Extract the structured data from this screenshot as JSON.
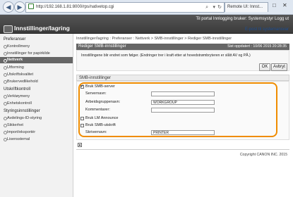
{
  "browser": {
    "url": "http://192.168.1.81:8000/rps/nativetop.cgi",
    "tab_label": "Remote UI: Innst...",
    "back_icon": "back-arrow-icon",
    "forward_icon": "forward-arrow-icon",
    "refresh_icon": "refresh-icon",
    "lock_icon": "lock-icon",
    "window_controls": [
      "□",
      "✕"
    ]
  },
  "header": {
    "top_links": "Til portal   Innlogging bruker: Systemsystyr   Logg ut",
    "user": "",
    "title": "Innstillinger/lagring",
    "email_link": "E-post til systemansvar"
  },
  "sidebar": {
    "categories": [
      {
        "name": "Preferanser",
        "items": [
          {
            "label": "Kontrollmeny",
            "active": false
          },
          {
            "label": "Innstillinger for papirkilde",
            "active": false
          },
          {
            "label": "Nettverk",
            "active": true
          },
          {
            "label": "Utforming",
            "active": false
          },
          {
            "label": "Utskriftskvalitet",
            "active": false
          },
          {
            "label": "Brukervedlikehold",
            "active": false
          }
        ]
      },
      {
        "name": "Utskriftkontroll",
        "items": [
          {
            "label": "Verktøymeny",
            "active": false
          },
          {
            "label": "Enhetskontroll",
            "active": false
          }
        ]
      },
      {
        "name": "Styringsinnstillinger",
        "items": [
          {
            "label": "Avdelings-ID-styring",
            "active": false
          },
          {
            "label": "Sikkerhet",
            "active": false
          },
          {
            "label": "Import/eksportér",
            "active": false
          },
          {
            "label": "Lisensstemal",
            "active": false
          }
        ]
      }
    ]
  },
  "main": {
    "breadcrumb": "Innstillinger/lagring : Preferanser : Nettverk > SMB-innstillinger > Rediger SMB-innstillinger",
    "edit_bar_title": "Rediger SMB-innstillinger",
    "edit_bar_right": "Sist oppdatert : 10/06 2015 20:28:35",
    "message": "Innstillingene blir endret som følger. (Endringer trer i kraft etter at hovedstrømbryteren er slått AV og PÅ.)",
    "ok_label": "OK",
    "cancel_label": "Avbryt",
    "section_title": "SMB-innstillinger",
    "fields": {
      "use_smb_server": {
        "label": "Bruk SMB-server",
        "checked": true
      },
      "server_name_label": "Servernavn:",
      "server_name_value": "",
      "workgroup_label": "Arbeidsgruppenavn:",
      "workgroup_value": "WORKGROUP",
      "comment_label": "Kommentarer:",
      "comment_value": "",
      "lm_announce": {
        "label": "Bruk LM Announce",
        "checked": false
      },
      "smb_print": {
        "label": "Bruk SMB-utskrift",
        "checked": false
      },
      "printer_name_label": "Skrivernavn:",
      "printer_name_value": "PRINTER"
    }
  },
  "footer": {
    "copyright": "Copyright CANON INC. 2015"
  },
  "colors": {
    "highlight_border": "#f08c00",
    "header_bg": "#444444",
    "bar_bg": "#666666"
  }
}
